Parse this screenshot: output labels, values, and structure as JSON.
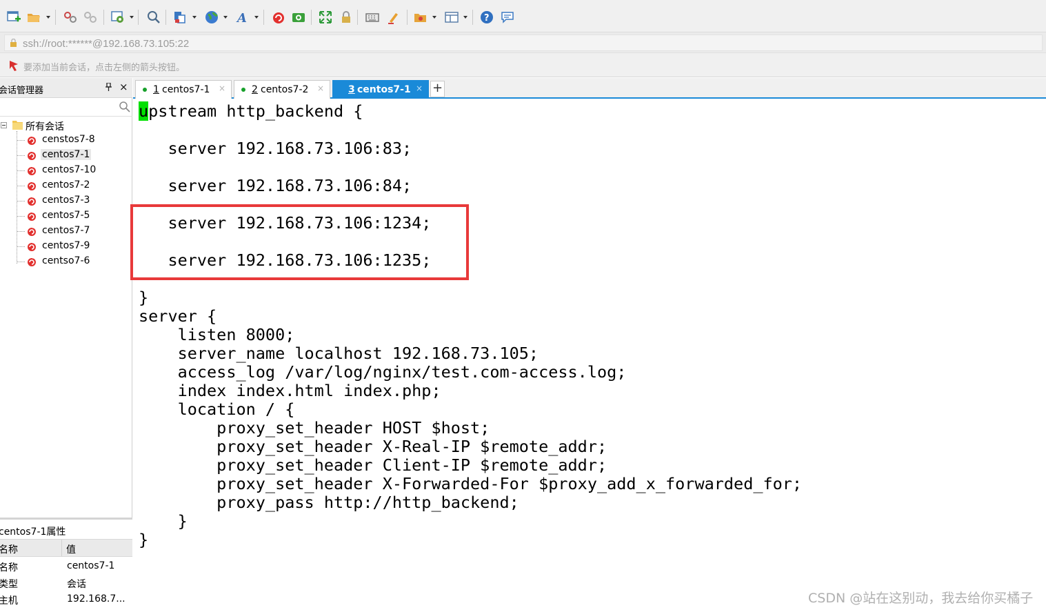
{
  "toolbar": {
    "icons": [
      "new-session-icon",
      "open-folder-icon",
      "reconnect-icon",
      "disconnect-icon",
      "session-properties-icon",
      "find-icon",
      "copy-icon",
      "globe-icon",
      "font-icon",
      "xshell-icon",
      "xftp-icon",
      "fullscreen-icon",
      "lock-icon",
      "keyboard-icon",
      "highlight-icon",
      "script-icon",
      "layout-icon",
      "help-icon",
      "chat-icon"
    ]
  },
  "address": "ssh://root:******@192.168.73.105:22",
  "hint": "要添加当前会话，点击左侧的箭头按钮。",
  "sidebar": {
    "title": "会话管理器",
    "pin": "ꟷ",
    "close": "×",
    "root_label": "所有会话",
    "items": [
      {
        "label": "censtos7-8"
      },
      {
        "label": "centos7-1"
      },
      {
        "label": "centos7-10"
      },
      {
        "label": "centos7-2"
      },
      {
        "label": "centos7-3"
      },
      {
        "label": "centos7-5"
      },
      {
        "label": "centos7-7"
      },
      {
        "label": "centos7-9"
      },
      {
        "label": "centso7-6"
      }
    ],
    "selected_index": 1
  },
  "properties": {
    "title": "centos7-1属性",
    "col_name": "名称",
    "col_value": "值",
    "rows": [
      {
        "key": "名称",
        "value": "centos7-1"
      },
      {
        "key": "类型",
        "value": "会话"
      },
      {
        "key": "主机",
        "value": "192.168.7..."
      }
    ]
  },
  "tabs": [
    {
      "num": "1",
      "label": "centos7-1",
      "active": false
    },
    {
      "num": "2",
      "label": "centos7-2",
      "active": false
    },
    {
      "num": "3",
      "label": "centos7-1",
      "active": true
    }
  ],
  "tab_close": "×",
  "tab_add": "+",
  "terminal": {
    "cursor_char": "u",
    "lines": [
      "pstream http_backend {",
      "   server 192.168.73.106:83;",
      "   server 192.168.73.106:84;",
      "   server 192.168.73.106:1234;",
      "   server 192.168.73.106:1235;",
      "}",
      "server {",
      "    listen 8000;",
      "    server_name localhost 192.168.73.105;",
      "    access_log /var/log/nginx/test.com-access.log;",
      "    index index.html index.php;",
      "    location / {",
      "        proxy_set_header HOST $host;",
      "        proxy_set_header X-Real-IP $remote_addr;",
      "        proxy_set_header Client-IP $remote_addr;",
      "        proxy_set_header X-Forwarded-For $proxy_add_x_forwarded_for;",
      "        proxy_pass http://http_backend;",
      "    }",
      "}"
    ]
  },
  "colors": {
    "accent": "#1a8ad8",
    "highlight_border": "#e8393a",
    "cursor": "#00e000",
    "session_icon": "#e2302e"
  },
  "watermark": "CSDN @站在这别动，我去给你买橘子"
}
